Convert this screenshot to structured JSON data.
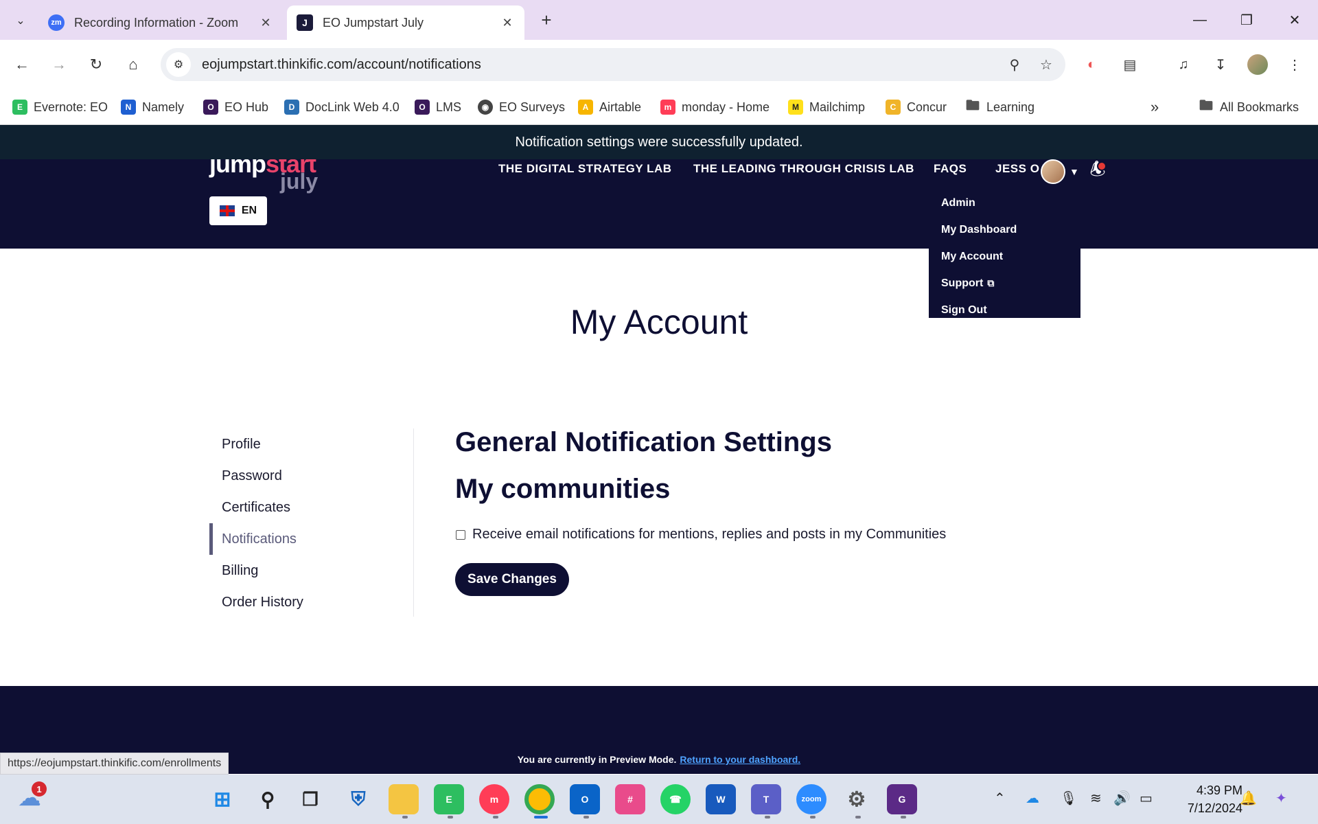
{
  "browser": {
    "tabs": [
      {
        "title": "Recording Information - Zoom",
        "favicon": "zm"
      },
      {
        "title": "EO Jumpstart July",
        "favicon": "J"
      }
    ],
    "url": "eojumpstart.thinkific.com/account/notifications",
    "bookmarks": [
      {
        "label": "Evernote: EO",
        "icon": "evernote-icon",
        "color": "#2dbe60"
      },
      {
        "label": "Namely",
        "icon": "namely-icon",
        "color": "#1f5fd1"
      },
      {
        "label": "EO Hub",
        "icon": "eo-icon",
        "color": "#3a1a5a"
      },
      {
        "label": "DocLink Web 4.0",
        "icon": "doclink-icon",
        "color": "#2b6fb2"
      },
      {
        "label": "LMS",
        "icon": "eo-icon",
        "color": "#3a1a5a"
      },
      {
        "label": "EO Surveys",
        "icon": "globe-icon",
        "color": "#444444"
      },
      {
        "label": "Airtable",
        "icon": "airtable-icon",
        "color": "#f7b500"
      },
      {
        "label": "monday - Home",
        "icon": "monday-icon",
        "color": "#ff3d57"
      },
      {
        "label": "Mailchimp",
        "icon": "mailchimp-icon",
        "color": "#ffe01b"
      },
      {
        "label": "Concur",
        "icon": "concur-icon",
        "color": "#f0b429"
      },
      {
        "label": "Learning",
        "icon": "folder-icon",
        "color": "#555555"
      }
    ],
    "all_bookmarks": "All Bookmarks",
    "status_url": "https://eojumpstart.thinkific.com/enrollments"
  },
  "toast": "Notification settings were successfully updated.",
  "header": {
    "logo_jump": "jump",
    "logo_start": "start",
    "logo_july": "july",
    "language": "EN",
    "nav": [
      "THE DIGITAL STRATEGY LAB",
      "THE LEADING THROUGH CRISIS LAB",
      "FAQS"
    ],
    "user_name": "JESS O",
    "dropdown": [
      "Admin",
      "My Dashboard",
      "My Account",
      "Support",
      "Sign Out"
    ]
  },
  "page_title": "My Account",
  "sidebar": [
    {
      "label": "Profile",
      "active": false
    },
    {
      "label": "Password",
      "active": false
    },
    {
      "label": "Certificates",
      "active": false
    },
    {
      "label": "Notifications",
      "active": true
    },
    {
      "label": "Billing",
      "active": false
    },
    {
      "label": "Order History",
      "active": false
    }
  ],
  "settings": {
    "heading": "General Notification Settings",
    "subheading": "My communities",
    "checkbox_label": "Receive email notifications for mentions, replies and posts in my Communities",
    "checkbox_checked": false,
    "save_label": "Save Changes"
  },
  "preview": {
    "text": "You are currently in Preview Mode.",
    "link": "Return to your dashboard."
  },
  "taskbar": {
    "time": "4:39 PM",
    "date": "7/12/2024",
    "weather_badge": "1"
  },
  "colors": {
    "brand_navy": "#0e0f33",
    "brand_pink": "#e8436a",
    "toast_bg": "#0f2130",
    "link_blue": "#4fa3ff"
  }
}
